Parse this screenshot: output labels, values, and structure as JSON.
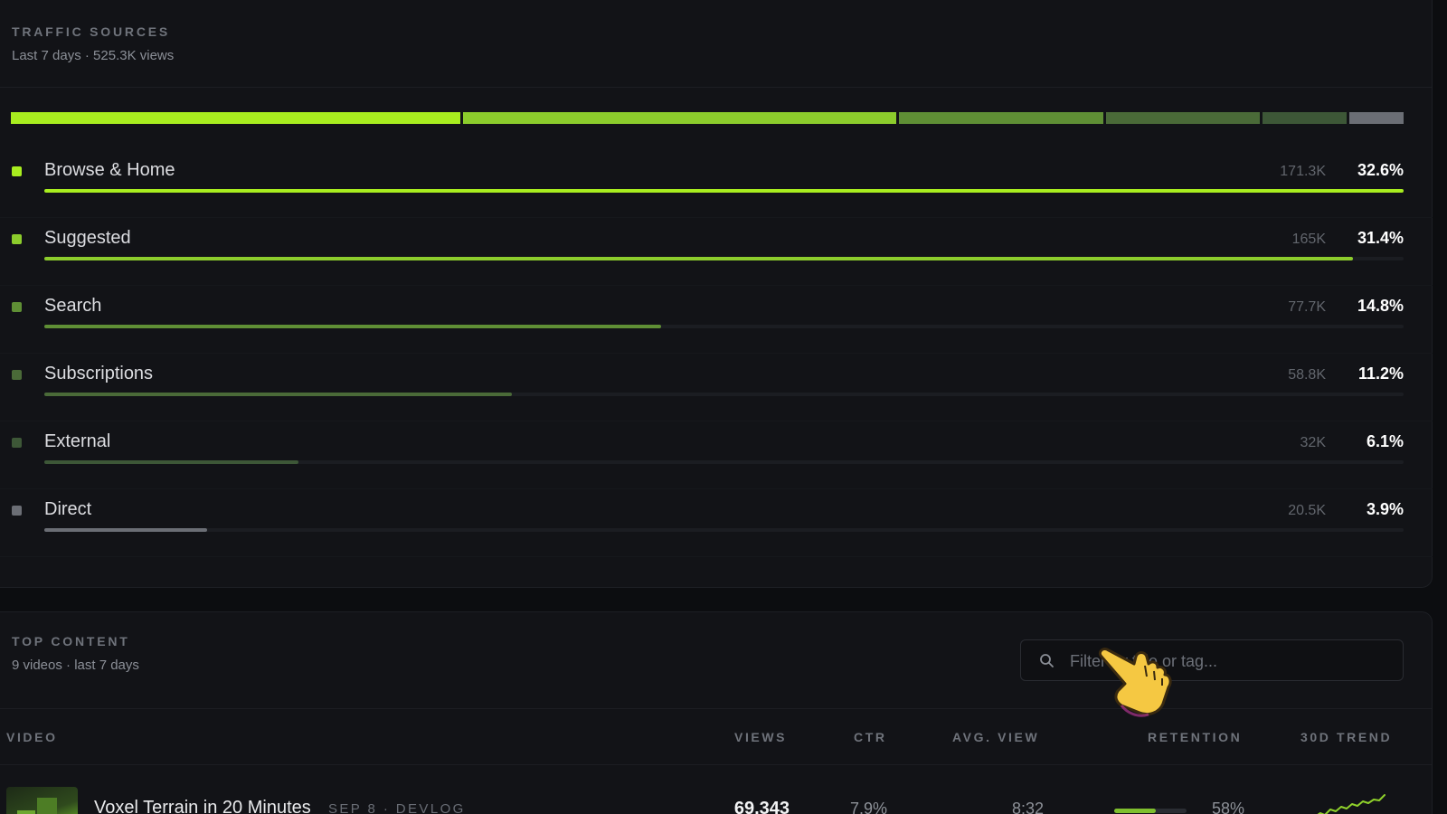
{
  "traffic": {
    "title": "TRAFFIC SOURCES",
    "subtitle": "Last 7 days · 525.3K views",
    "colors": {
      "browse": "#a8ed1f",
      "suggested": "#8ccc2c",
      "search": "#5f8f35",
      "subscriptions": "#4a6a38",
      "external": "#3d5737",
      "direct": "#6b6e75"
    },
    "sources": [
      {
        "name": "Browse & Home",
        "views": "171.3K",
        "percent": "32.6%",
        "share": 32.6,
        "bar_fraction": 1.0,
        "color_key": "browse"
      },
      {
        "name": "Suggested",
        "views": "165K",
        "percent": "31.4%",
        "share": 31.4,
        "bar_fraction": 0.963,
        "color_key": "suggested"
      },
      {
        "name": "Search",
        "views": "77.7K",
        "percent": "14.8%",
        "share": 14.8,
        "bar_fraction": 0.454,
        "color_key": "search"
      },
      {
        "name": "Subscriptions",
        "views": "58.8K",
        "percent": "11.2%",
        "share": 11.2,
        "bar_fraction": 0.344,
        "color_key": "subscriptions"
      },
      {
        "name": "External",
        "views": "32K",
        "percent": "6.1%",
        "share": 6.1,
        "bar_fraction": 0.187,
        "color_key": "external"
      },
      {
        "name": "Direct",
        "views": "20.5K",
        "percent": "3.9%",
        "share": 3.9,
        "bar_fraction": 0.12,
        "color_key": "direct"
      }
    ]
  },
  "top_content": {
    "title": "TOP CONTENT",
    "subtitle": "9 videos · last 7 days",
    "filter_placeholder": "Filter by title or tag...",
    "columns": {
      "video": "VIDEO",
      "views": "VIEWS",
      "ctr": "CTR",
      "avg_view": "AVG. VIEW",
      "retention": "RETENTION",
      "trend": "30D TREND"
    },
    "rows": [
      {
        "title": "Voxel Terrain in 20 Minutes",
        "meta": "SEP 8 · DEVLOG",
        "views": "69,343",
        "ctr": "7.9%",
        "avg_view": "8:32",
        "retention": "58%",
        "retention_fraction": 0.58,
        "trend_color": "#8fd12b"
      }
    ]
  },
  "icons": {
    "search": "search-icon",
    "cursor": "pointing-hand-cursor-icon"
  }
}
